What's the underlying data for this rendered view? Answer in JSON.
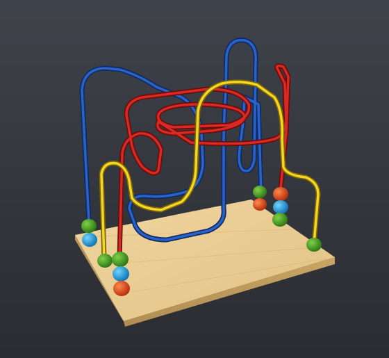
{
  "scene": {
    "subject": "bead maze toy",
    "background_color": "#383b41",
    "base_color": "#e8c98c",
    "wire_colors": {
      "blue": "#1f4fa8",
      "red": "#c91e1e",
      "yellow": "#f0d21c"
    },
    "bead_colors": {
      "green": "#3b9b1c",
      "blue": "#1aa3e0",
      "red": "#e0401a"
    },
    "bead_clusters": [
      {
        "name": "front-left",
        "beads": [
          "green",
          "blue"
        ]
      },
      {
        "name": "front-center",
        "beads": [
          "green",
          "green",
          "blue",
          "red"
        ]
      },
      {
        "name": "back-center",
        "beads": [
          "green",
          "red"
        ]
      },
      {
        "name": "back-right",
        "beads": [
          "red",
          "blue",
          "green"
        ]
      },
      {
        "name": "front-right",
        "beads": [
          "green"
        ]
      }
    ]
  }
}
